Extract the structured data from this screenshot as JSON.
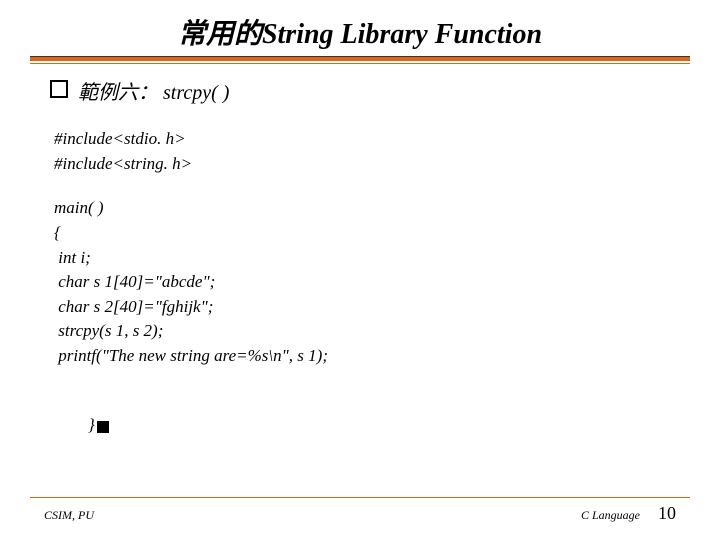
{
  "title": "常用的String Library Function",
  "bullet": "範例六： strcpy( )",
  "code": {
    "l1": "#include<stdio. h>",
    "l2": "#include<string. h>",
    "l3": "main( )",
    "l4": "{",
    "l5": " int i;",
    "l6": " char s 1[40]=\"abcde\";",
    "l7": " char s 2[40]=\"fghijk\";",
    "l8": " strcpy(s 1, s 2);",
    "l9": " printf(\"The new string are=%s\\n\", s 1);",
    "l10": "}"
  },
  "footer": {
    "left": "CSIM, PU",
    "rightLabel": "C Language",
    "page": "10"
  }
}
